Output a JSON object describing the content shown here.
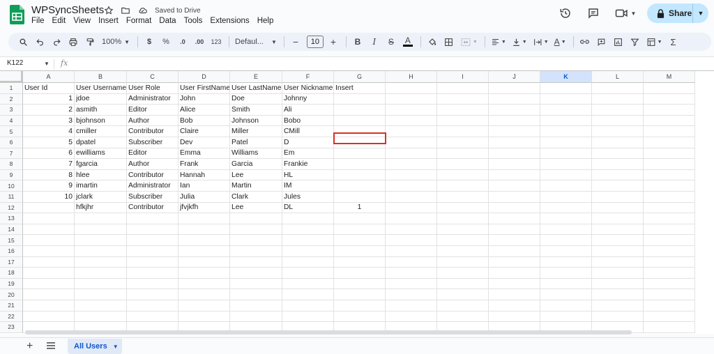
{
  "app": {
    "doc_title": "WPSyncSheets",
    "save_status": "Saved to Drive",
    "share_label": "Share",
    "menu": [
      "File",
      "Edit",
      "View",
      "Insert",
      "Format",
      "Data",
      "Tools",
      "Extensions",
      "Help"
    ]
  },
  "toolbar": {
    "zoom": "100%",
    "currency": "$",
    "percent": "%",
    "dec_decrease": ".0",
    "dec_increase": ".00",
    "number_format": "123",
    "font": "Defaul...",
    "font_size": "10",
    "bold": "B",
    "italic": "I",
    "strike": "S",
    "text_color": "A",
    "sum": "Σ"
  },
  "formula_bar": {
    "name_box": "K122",
    "fx": "fx"
  },
  "grid": {
    "columns": [
      "A",
      "B",
      "C",
      "D",
      "E",
      "F",
      "G",
      "H",
      "I",
      "J",
      "K",
      "L",
      "M"
    ],
    "selected_column": "K",
    "row_numbers": [
      "1",
      "2",
      "3",
      "4",
      "5",
      "6",
      "7",
      "8",
      "9",
      "10",
      "11",
      "12",
      "13",
      "14",
      "15",
      "16",
      "17",
      "18",
      "19",
      "20",
      "21",
      "22",
      "23"
    ],
    "rows": [
      [
        "User Id",
        "User Username",
        "User Role",
        "User FirstName",
        "User LastName",
        "User Nickname",
        "Insert"
      ],
      [
        "1",
        "jdoe",
        "Administrator",
        "John",
        "Doe",
        "Johnny",
        ""
      ],
      [
        "2",
        "asmith",
        "Editor",
        "Alice",
        "Smith",
        "Ali",
        ""
      ],
      [
        "3",
        "bjohnson",
        "Author",
        "Bob",
        "Johnson",
        "Bobo",
        ""
      ],
      [
        "4",
        "cmiller",
        "Contributor",
        "Claire",
        "Miller",
        "CMill",
        ""
      ],
      [
        "5",
        "dpatel",
        "Subscriber",
        "Dev",
        "Patel",
        "D",
        ""
      ],
      [
        "6",
        "ewilliams",
        "Editor",
        "Emma",
        "Williams",
        "Em",
        ""
      ],
      [
        "7",
        "fgarcia",
        "Author",
        "Frank",
        "Garcia",
        "Frankie",
        ""
      ],
      [
        "8",
        "hlee",
        "Contributor",
        "Hannah",
        "Lee",
        "HL",
        ""
      ],
      [
        "9",
        "imartin",
        "Administrator",
        "Ian",
        "Martin",
        "IM",
        ""
      ],
      [
        "10",
        "jclark",
        "Subscriber",
        "Julia",
        "Clark",
        "Jules",
        ""
      ],
      [
        "",
        "hfkjhr",
        "Contributor",
        "jfvjkfh",
        "Lee",
        "DL",
        "1"
      ]
    ]
  },
  "sheets": {
    "active_tab": "All Users",
    "add_label": "+"
  },
  "colors": {
    "accent": "#0b57d0",
    "share_bg": "#c2e7ff",
    "highlight": "#d93025",
    "sheets_green": "#0f9d58"
  },
  "icons": [
    "sheets-logo-icon",
    "star-icon",
    "folder-icon",
    "cloud-icon",
    "history-icon",
    "comment-icon",
    "video-icon",
    "lock-icon",
    "search-icon",
    "undo-icon",
    "redo-icon",
    "print-icon",
    "paint-format-icon",
    "text-color-icon",
    "fill-color-icon",
    "borders-icon",
    "merge-icon",
    "align-icon",
    "valign-icon",
    "wrap-icon",
    "rotate-icon",
    "link-icon",
    "insert-comment-icon",
    "chart-icon",
    "filter-icon",
    "filter-views-icon",
    "function-icon",
    "all-sheets-icon"
  ]
}
